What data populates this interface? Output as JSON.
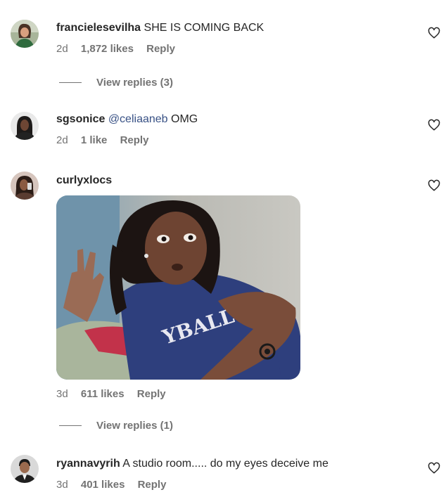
{
  "comments": [
    {
      "username": "francielesevilha",
      "text": "SHE IS COMING BACK",
      "age": "2d",
      "likes": "1,872 likes",
      "reply": "Reply",
      "view_replies": "View replies (3)"
    },
    {
      "username": "sgsonice",
      "mention": "@celiaaneb",
      "text": "OMG",
      "age": "2d",
      "likes": "1 like",
      "reply": "Reply"
    },
    {
      "username": "curlyxlocs",
      "text": "",
      "age": "3d",
      "likes": "611 likes",
      "reply": "Reply",
      "view_replies": "View replies (1)",
      "gif_caption": "YBALL"
    },
    {
      "username": "ryannavyrih",
      "text": "A studio room..... do my eyes deceive me",
      "age": "3d",
      "likes": "401 likes",
      "reply": "Reply"
    }
  ],
  "icons": {
    "like": "heart-outline-icon"
  },
  "colors": {
    "mention": "#385185",
    "meta": "#737373",
    "text": "#262626"
  }
}
